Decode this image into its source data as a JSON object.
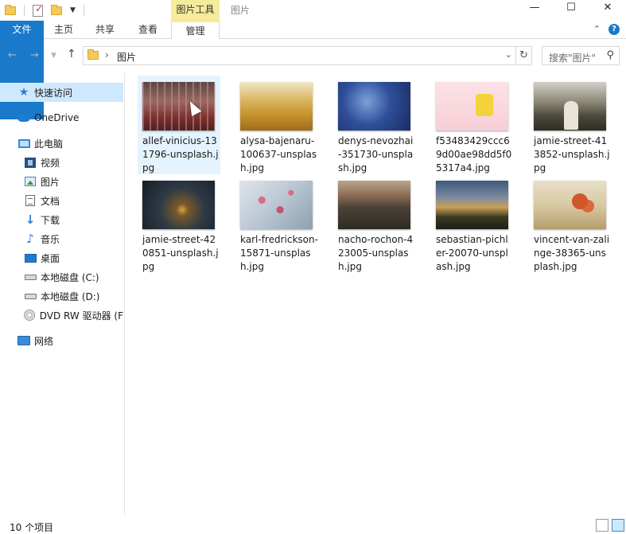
{
  "window": {
    "title": "图片",
    "context_tab": "图片工具",
    "controls": {
      "minimize": "—",
      "maximize": "☐",
      "close": "✕"
    }
  },
  "ribbon": {
    "tabs": [
      {
        "label": "文件"
      },
      {
        "label": "主页"
      },
      {
        "label": "共享"
      },
      {
        "label": "查看"
      },
      {
        "label": "管理"
      }
    ],
    "collapse_glyph": "⌃",
    "help_glyph": "?"
  },
  "address": {
    "path_label": "图片",
    "search_placeholder": "搜索\"图片\""
  },
  "nav": {
    "items": [
      {
        "label": "快速访问",
        "icon": "quick-access-star-icon"
      },
      {
        "label": "OneDrive",
        "icon": "onedrive-cloud-icon"
      },
      {
        "label": "此电脑",
        "icon": "this-pc-icon"
      },
      {
        "label": "视频",
        "icon": "videos-icon"
      },
      {
        "label": "图片",
        "icon": "pictures-icon"
      },
      {
        "label": "文档",
        "icon": "documents-icon"
      },
      {
        "label": "下载",
        "icon": "downloads-icon"
      },
      {
        "label": "音乐",
        "icon": "music-icon"
      },
      {
        "label": "桌面",
        "icon": "desktop-icon"
      },
      {
        "label": "本地磁盘 (C:)",
        "icon": "drive-icon"
      },
      {
        "label": "本地磁盘 (D:)",
        "icon": "drive-icon"
      },
      {
        "label": "DVD RW 驱动器 (F",
        "icon": "dvd-drive-icon"
      },
      {
        "label": "网络",
        "icon": "network-icon"
      }
    ]
  },
  "files": [
    {
      "name": "allef-vinicius-131796-unsplash.jpg"
    },
    {
      "name": "alysa-bajenaru-100637-unsplash.jpg"
    },
    {
      "name": "denys-nevozhai-351730-unsplash.jpg"
    },
    {
      "name": "f53483429ccc69d00ae98dd5f05317a4.jpg"
    },
    {
      "name": "jamie-street-413852-unsplash.jpg"
    },
    {
      "name": "jamie-street-420851-unsplash.jpg"
    },
    {
      "name": "karl-fredrickson-15871-unsplash.jpg"
    },
    {
      "name": "nacho-rochon-423005-unsplash.jpg"
    },
    {
      "name": "sebastian-pichler-20070-unsplash.jpg"
    },
    {
      "name": "vincent-van-zalinge-38365-unsplash.jpg"
    }
  ],
  "status": {
    "item_count": "10 个项目"
  },
  "colors": {
    "accent": "#1979ca",
    "context_tab": "#f6eb9d",
    "selection": "#cde8ff"
  }
}
